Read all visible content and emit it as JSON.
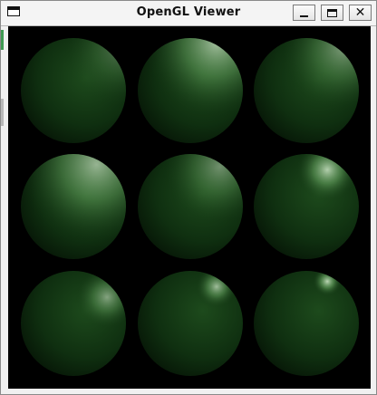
{
  "window": {
    "title": "OpenGL Viewer",
    "controls": {
      "minimize": "minimize",
      "maximize": "maximize",
      "close": "close"
    }
  },
  "scene": {
    "background": "#000000",
    "sphere_color": "#0f2f10",
    "highlight_color": "#cfe9c8",
    "rows": 3,
    "cols": 3,
    "spheres": [
      {
        "row": 0,
        "col": 0,
        "name": "sphere-r1c1"
      },
      {
        "row": 0,
        "col": 1,
        "name": "sphere-r1c2"
      },
      {
        "row": 0,
        "col": 2,
        "name": "sphere-r1c3"
      },
      {
        "row": 1,
        "col": 0,
        "name": "sphere-r2c1"
      },
      {
        "row": 1,
        "col": 1,
        "name": "sphere-r2c2"
      },
      {
        "row": 1,
        "col": 2,
        "name": "sphere-r2c3"
      },
      {
        "row": 2,
        "col": 0,
        "name": "sphere-r3c1"
      },
      {
        "row": 2,
        "col": 1,
        "name": "sphere-r3c2"
      },
      {
        "row": 2,
        "col": 2,
        "name": "sphere-r3c3"
      }
    ]
  }
}
